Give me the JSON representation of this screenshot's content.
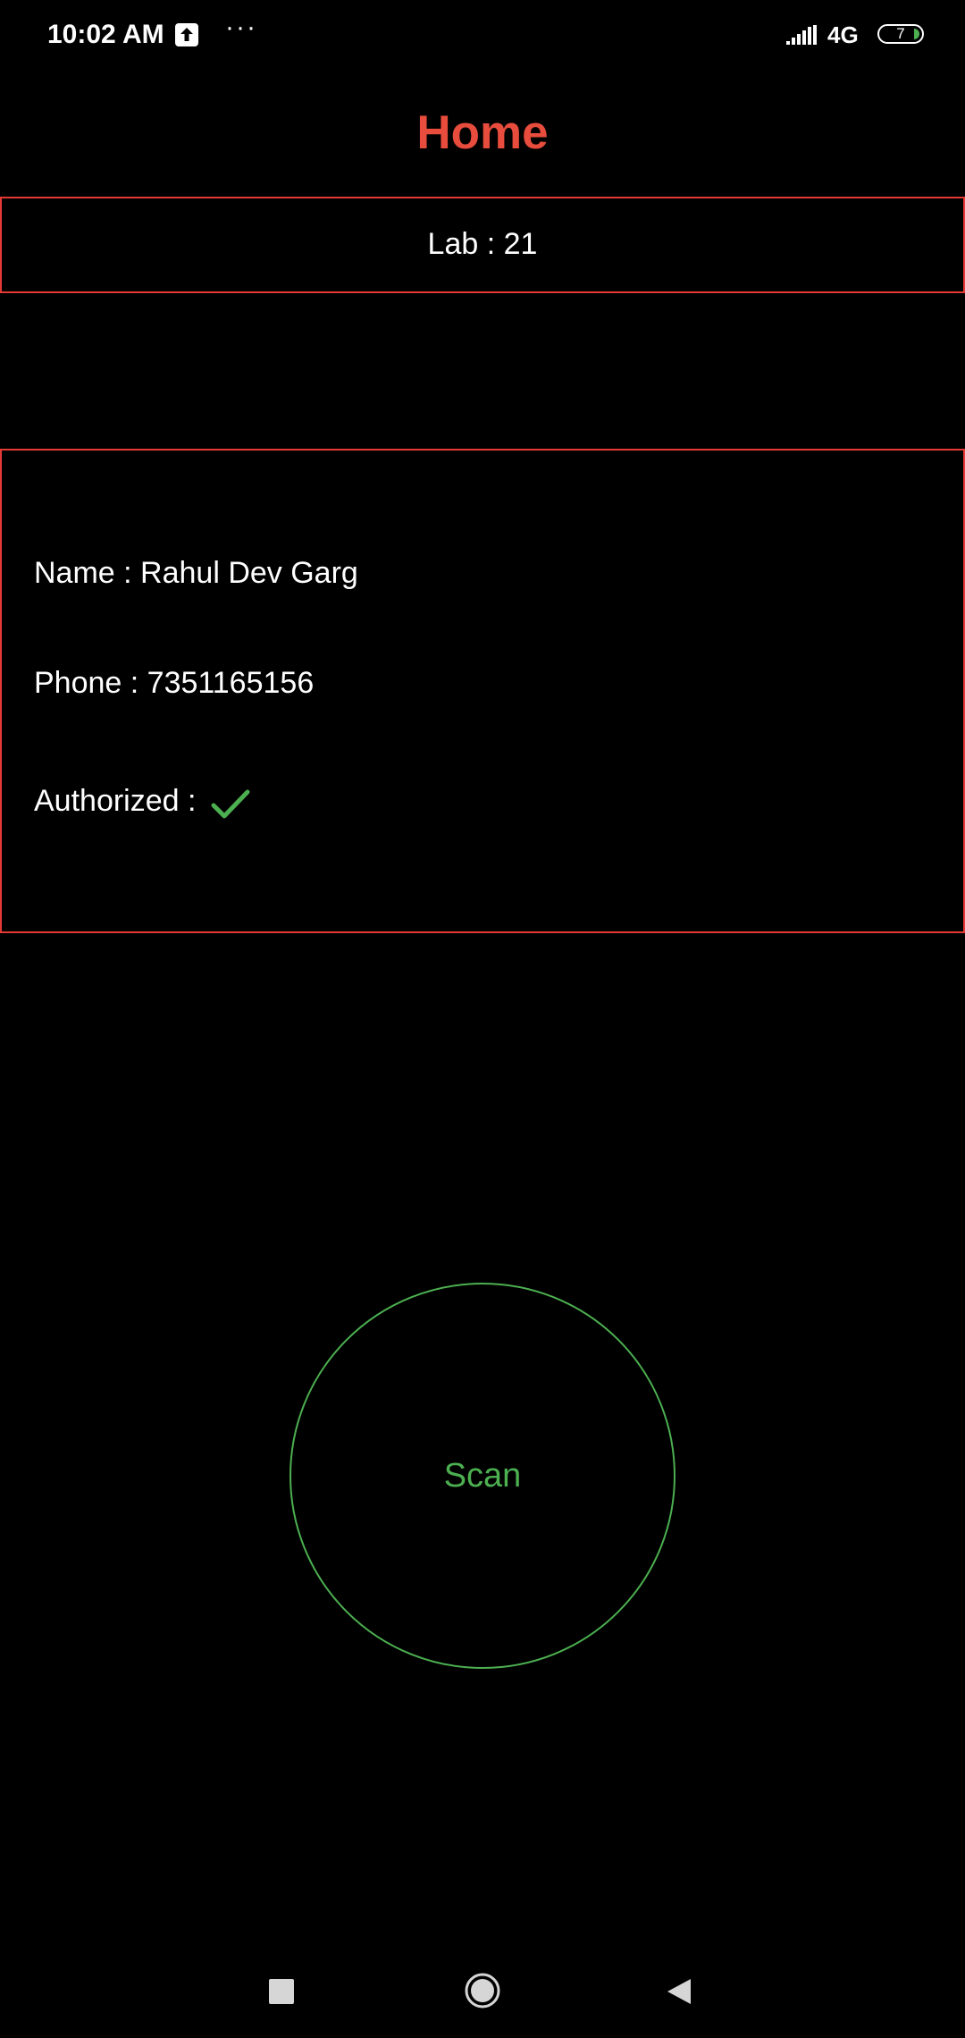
{
  "status_bar": {
    "time": "10:02 AM",
    "upload_icon": "upload-arrow-icon",
    "more_dots": "···",
    "network": "4G",
    "battery_level": "7"
  },
  "header": {
    "title": "Home",
    "title_color": "#e74c3c"
  },
  "lab": {
    "label": "Lab : 21"
  },
  "user": {
    "name_label": "Name : Rahul Dev Garg",
    "phone_label": "Phone : 7351165156",
    "authorized_label": "Authorized :",
    "authorized_icon": "check-icon",
    "authorized_color": "#4caf50"
  },
  "scan": {
    "label": "Scan",
    "color": "#4caf50"
  },
  "nav": {
    "recents_icon": "square-recents-icon",
    "home_icon": "circle-home-icon",
    "back_icon": "triangle-back-icon"
  },
  "colors": {
    "background": "#000000",
    "border_accent": "#e53935"
  }
}
